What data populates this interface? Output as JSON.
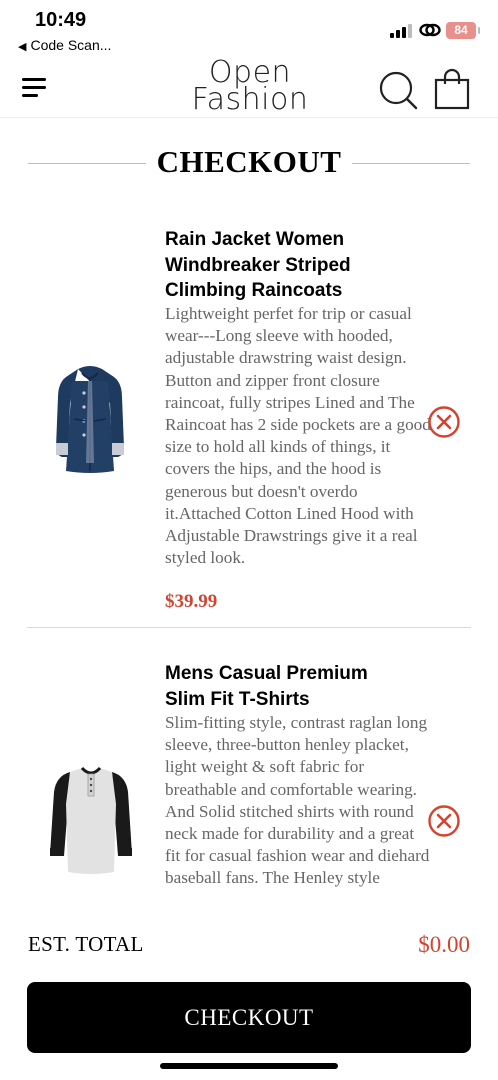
{
  "status_bar": {
    "time": "10:49",
    "back_label": "Code Scan...",
    "battery": "84"
  },
  "header": {
    "logo_line1": "Open",
    "logo_line2": "Fashion",
    "icons": [
      "menu-icon",
      "search-icon",
      "shopping-bag-icon"
    ]
  },
  "page": {
    "title": "CHECKOUT"
  },
  "items": [
    {
      "name": "Rain Jacket Women Windbreaker Striped Climbing Raincoats",
      "description": "Lightweight perfet for trip or casual wear---Long sleeve with hooded, adjustable drawstring waist design. Button and zipper front closure raincoat, fully stripes Lined and The Raincoat has 2 side pockets are a good size to hold all kinds of things, it covers the hips, and the hood is generous but doesn't overdo it.Attached Cotton Lined Hood with Adjustable Drawstrings give it a real styled look.",
      "price": "$39.99",
      "image": "navy-raincoat"
    },
    {
      "name": "Mens Casual Premium Slim Fit T-Shirts",
      "description": "Slim-fitting style, contrast raglan long sleeve, three-button henley placket, light weight & soft fabric for breathable and comfortable wearing. And Solid stitched shirts with round neck made for durability and a great fit for casual fashion wear and diehard baseball fans. The Henley style",
      "price": "",
      "image": "raglan-henley-shirt"
    }
  ],
  "footer": {
    "total_label": "EST. TOTAL",
    "total_value": "$0.00",
    "checkout_label": "CHECKOUT"
  },
  "colors": {
    "accent": "#d5432f",
    "button_bg": "#000000",
    "button_text": "#ffffff"
  }
}
